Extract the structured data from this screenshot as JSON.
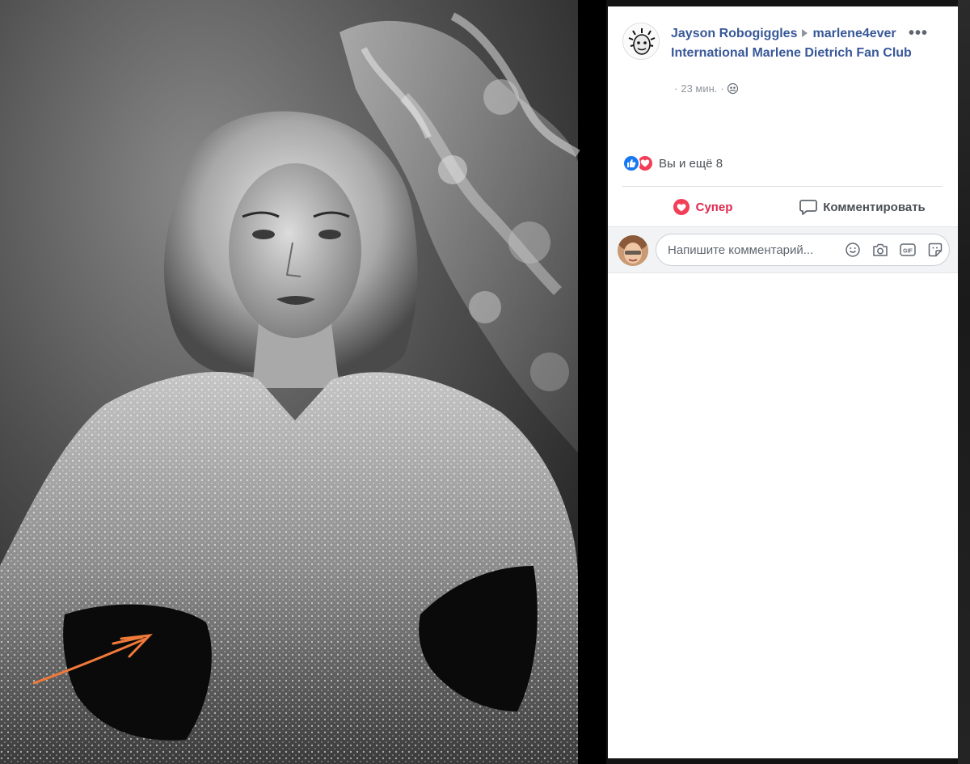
{
  "post": {
    "author": "Jayson Robogiggles",
    "group_user": "marlene4ever",
    "group_name": "International Marlene Dietrich Fan Club",
    "time": "23 мин.",
    "more_label": "•••",
    "privacy_icon": "friends-icon"
  },
  "reactions": {
    "summary": "Вы и ещё 8",
    "icons": [
      "like-icon",
      "love-icon"
    ]
  },
  "actions": {
    "super_label": "Супер",
    "comment_label": "Комментировать"
  },
  "comment_box": {
    "placeholder": "Напишите комментарий...",
    "icons": [
      "emoji-icon",
      "camera-icon",
      "gif-icon",
      "sticker-icon"
    ]
  },
  "colors": {
    "link": "#385898",
    "super": "#e2264d",
    "like": "#1877f2",
    "love": "#f33e58",
    "annotation_arrow": "#f07a3a"
  }
}
